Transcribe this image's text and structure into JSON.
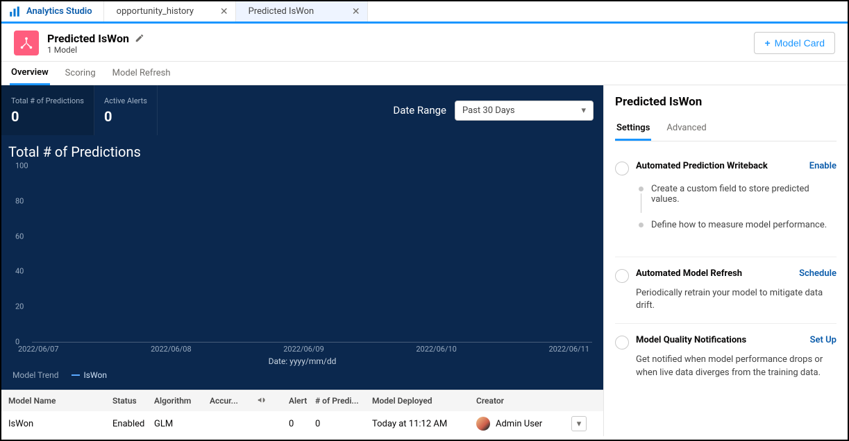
{
  "topbar": {
    "app_name": "Analytics Studio",
    "tabs": [
      {
        "label": "opportunity_history"
      },
      {
        "label": "Predicted IsWon"
      }
    ]
  },
  "header": {
    "title": "Predicted IsWon",
    "subtitle": "1 Model",
    "button_label": "Model Card"
  },
  "sub_tabs": [
    "Overview",
    "Scoring",
    "Model Refresh"
  ],
  "stats": {
    "total_label": "Total # of Predictions",
    "total_value": "0",
    "alerts_label": "Active Alerts",
    "alerts_value": "0",
    "date_range_label": "Date Range",
    "date_range_value": "Past 30 Days"
  },
  "chart_data": {
    "type": "line",
    "title": "Total # of Predictions",
    "xlabel": "Date: yyyy/mm/dd",
    "x_ticks": [
      "2022/06/07",
      "2022/06/08",
      "2022/06/09",
      "2022/06/10",
      "2022/06/11"
    ],
    "y_ticks": [
      "0",
      "20",
      "40",
      "60",
      "80",
      "100"
    ],
    "ylim": [
      0,
      100
    ],
    "series": [
      {
        "name": "IsWon",
        "values": [
          0,
          0,
          0,
          0,
          0
        ]
      }
    ],
    "legend_title": "Model Trend",
    "axis_line_value": 0
  },
  "table": {
    "headers": {
      "model_name": "Model Name",
      "status": "Status",
      "algorithm": "Algorithm",
      "accuracy": "Accur...",
      "alerts": "Alert",
      "predictions": "# of Predi...",
      "deployed": "Model Deployed",
      "creator": "Creator"
    },
    "rows": [
      {
        "model_name": "IsWon",
        "status": "Enabled",
        "algorithm": "GLM",
        "accuracy": "",
        "alerts": "0",
        "predictions": "0",
        "deployed": "Today at 11:12 AM",
        "creator": "Admin User"
      }
    ]
  },
  "right_panel": {
    "title": "Predicted IsWon",
    "tabs": [
      "Settings",
      "Advanced"
    ],
    "settings": {
      "writeback": {
        "title": "Automated Prediction Writeback",
        "action": "Enable",
        "step1": "Create a custom field to store predicted values.",
        "step2": "Define how to measure model performance."
      },
      "refresh": {
        "title": "Automated Model Refresh",
        "action": "Schedule",
        "desc": "Periodically retrain your model to mitigate data drift."
      },
      "quality": {
        "title": "Model Quality Notifications",
        "action": "Set Up",
        "desc": "Get notified when model performance drops or when live data diverges from the training data."
      }
    }
  }
}
